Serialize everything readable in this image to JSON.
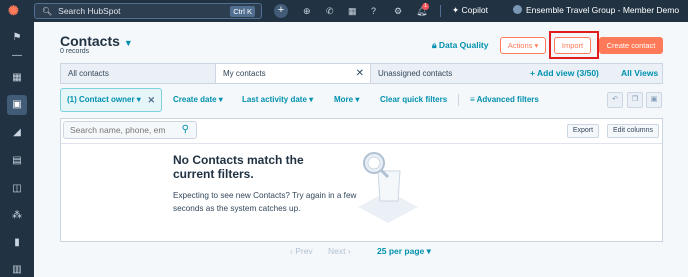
{
  "topbar": {
    "search_placeholder": "Search HubSpot",
    "shortcut": "Ctrl K",
    "copilot_label": "Copilot",
    "account_name": "Ensemble Travel Group - Member Demo",
    "notification_count": "1"
  },
  "header": {
    "title": "Contacts",
    "record_count": "0 records",
    "data_quality_label": "Data Quality",
    "actions_label": "Actions",
    "import_label": "Import",
    "create_label": "Create contact"
  },
  "tabs": {
    "items": [
      "All contacts",
      "My contacts",
      "Unassigned contacts"
    ],
    "add_view_label": "+ Add view (3/50)",
    "all_views_label": "All Views"
  },
  "filters": {
    "contact_owner_chip": "(1) Contact owner",
    "create_date": "Create date",
    "last_activity_date": "Last activity date",
    "more": "More",
    "clear_quick_filters": "Clear quick filters",
    "advanced_filters": "Advanced filters"
  },
  "table": {
    "search_placeholder": "Search name, phone, em",
    "export_label": "Export",
    "edit_columns_label": "Edit columns",
    "empty_title": "No Contacts match the current filters.",
    "empty_text": "Expecting to see new Contacts? Try again in a few seconds as the system catches up."
  },
  "pagination": {
    "prev_label": "Prev",
    "next_label": "Next",
    "per_page_label": "25 per page"
  },
  "colors": {
    "accent_orange": "#ff7a59",
    "link_teal": "#0091ae",
    "nav_dark": "#213343",
    "highlight_red": "#e01e1e"
  }
}
